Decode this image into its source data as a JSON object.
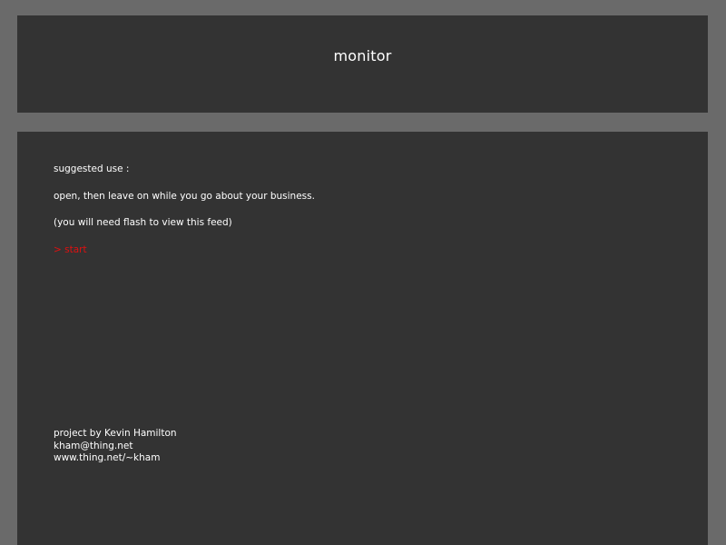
{
  "header": {
    "title": "monitor"
  },
  "main": {
    "suggested_label": "suggested use :",
    "instruction": "open, then leave on while you go about your business.",
    "flash_note": "(you will need flash to view this feed)",
    "start_link": "> start"
  },
  "credits": {
    "project": "project by Kevin Hamilton",
    "email": "kham@thing.net",
    "website": "www.thing.net/~kham"
  },
  "colors": {
    "page_background": "#6a6a6a",
    "panel_background": "#333333",
    "text": "#ffffff",
    "link": "#e01010"
  }
}
